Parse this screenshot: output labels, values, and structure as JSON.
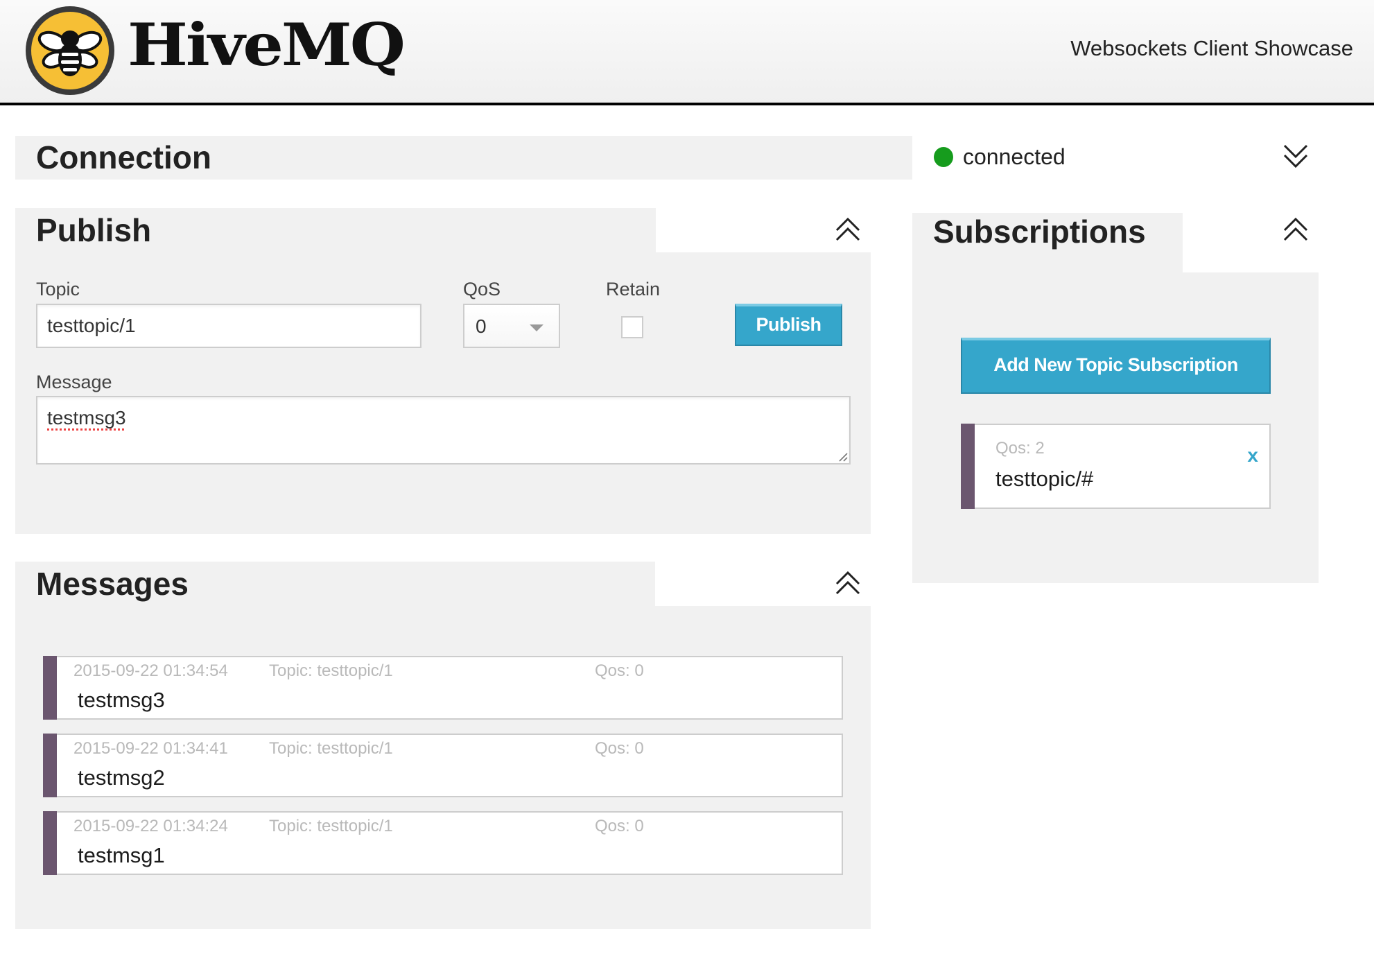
{
  "header": {
    "logo_text": "HiveMQ",
    "app_title": "Websockets Client Showcase",
    "brand_color": "#f6bf35"
  },
  "connection": {
    "title": "Connection",
    "status": "connected",
    "status_color": "#169c1d",
    "toggle_icon": "chevron-double-down-icon"
  },
  "publish": {
    "title": "Publish",
    "toggle_icon": "chevron-double-up-icon",
    "topic_label": "Topic",
    "topic_value": "testtopic/1",
    "qos_label": "QoS",
    "qos_value": "0",
    "retain_label": "Retain",
    "retain_checked": false,
    "publish_button": "Publish",
    "message_label": "Message",
    "message_value": "testmsg3"
  },
  "subscriptions": {
    "title": "Subscriptions",
    "toggle_icon": "chevron-double-up-icon",
    "add_button": "Add New Topic Subscription",
    "items": [
      {
        "qos": "Qos: 2",
        "topic": "testtopic/#",
        "remove_label": "x",
        "color": "#6b566f"
      }
    ]
  },
  "messages": {
    "title": "Messages",
    "toggle_icon": "chevron-double-up-icon",
    "items": [
      {
        "timestamp": "2015-09-22 01:34:54",
        "topic": "Topic: testtopic/1",
        "qos": "Qos: 0",
        "text": "testmsg3"
      },
      {
        "timestamp": "2015-09-22 01:34:41",
        "topic": "Topic: testtopic/1",
        "qos": "Qos: 0",
        "text": "testmsg2"
      },
      {
        "timestamp": "2015-09-22 01:34:24",
        "topic": "Topic: testtopic/1",
        "qos": "Qos: 0",
        "text": "testmsg1"
      }
    ]
  },
  "colors": {
    "accent_blue": "#35a6cb",
    "panel_bg": "#f1f1f1",
    "item_accent": "#6b566f"
  }
}
